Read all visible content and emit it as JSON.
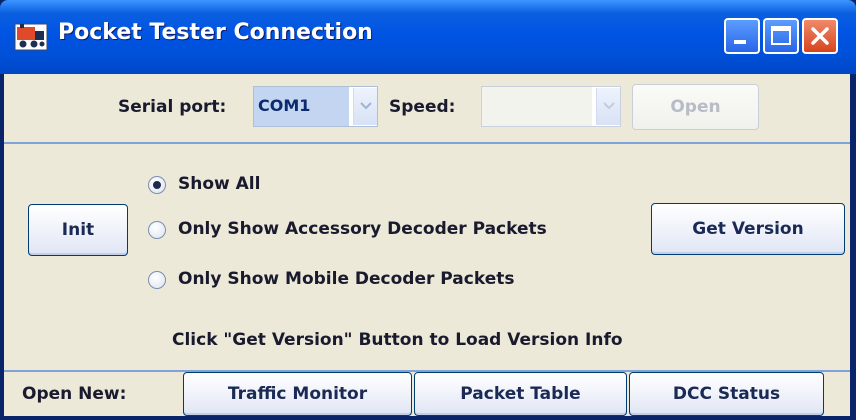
{
  "window": {
    "title": "Pocket Tester Connection"
  },
  "connection": {
    "serial_port_label": "Serial port:",
    "serial_port_value": "COM1",
    "speed_label": "Speed:",
    "speed_value": "",
    "open_button": "Open"
  },
  "controls": {
    "init_button": "Init",
    "get_version_button": "Get Version",
    "filter_options": [
      {
        "label": "Show All",
        "selected": true
      },
      {
        "label": "Only Show Accessory Decoder Packets",
        "selected": false
      },
      {
        "label": "Only Show Mobile Decoder Packets",
        "selected": false
      }
    ],
    "status_message": "Click \"Get Version\" Button to Load Version Info"
  },
  "open_new": {
    "label": "Open New:",
    "buttons": [
      "Traffic Monitor",
      "Packet Table",
      "DCC Status"
    ]
  },
  "icons": {
    "app": "locomotive-icon",
    "minimize": "minimize-icon",
    "maximize": "maximize-icon",
    "close": "close-icon",
    "dropdown": "chevron-down-icon"
  },
  "colors": {
    "titlebar": "#0054e3",
    "panel": "#ece9d8",
    "selection": "#c4d5f1",
    "close": "#d8431e"
  }
}
